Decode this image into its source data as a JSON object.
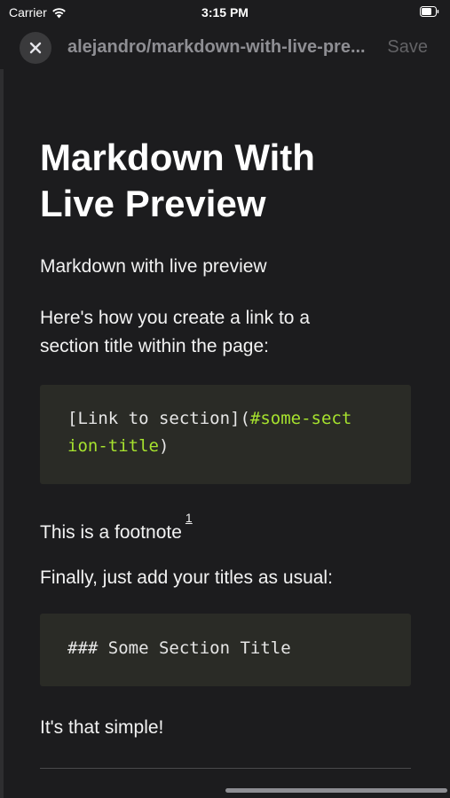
{
  "status_bar": {
    "carrier": "Carrier",
    "time": "3:15 PM",
    "icons": [
      "wifi-icon",
      "battery-icon"
    ]
  },
  "nav": {
    "title": "alejandro/markdown-with-live-pre...",
    "save_label": "Save",
    "close_icon": "close-icon"
  },
  "document": {
    "heading_line1": "Markdown With",
    "heading_line2": "Live Preview",
    "intro": "Markdown with live preview",
    "link_para_line1": "Here's how you create a link to a",
    "link_para_line2": "section title within the page:",
    "code1_line1_plain": "[Link to section](",
    "code1_line1_link": "#some-sect",
    "code1_line2_link": "ion-title",
    "code1_line2_plain": ")",
    "footnote_text": "This is a footnote",
    "footnote_ref": "1",
    "titles_para": "Finally, just add your titles as usual:",
    "code2_line": "### Some Section Title",
    "closing": "It's that simple!"
  },
  "colors": {
    "background": "#1c1c1e",
    "code_background": "#2a2b26",
    "code_link": "#a6e22e"
  }
}
